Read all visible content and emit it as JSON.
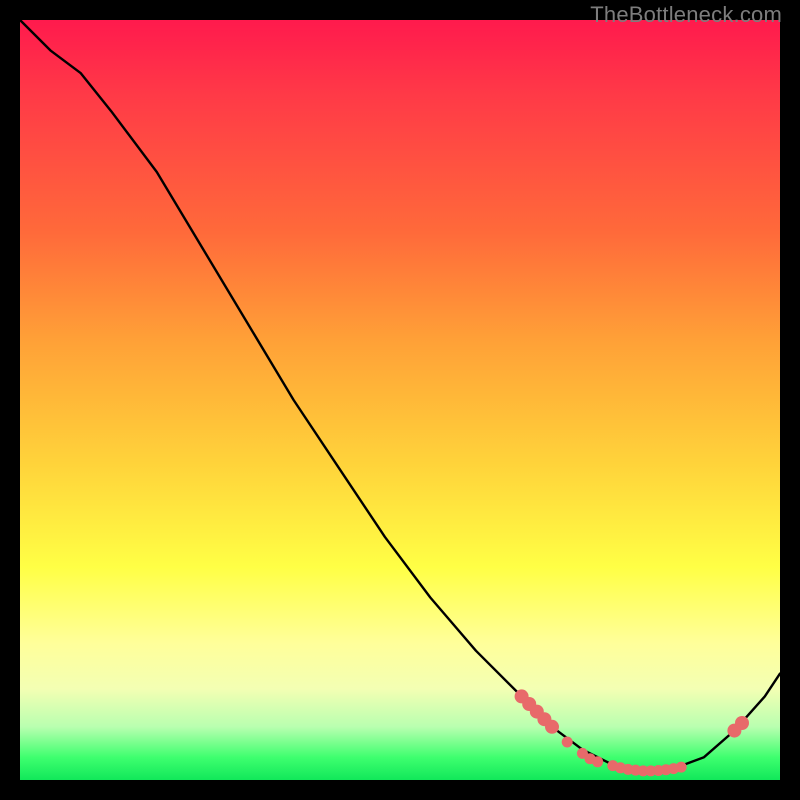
{
  "watermark": "TheBottleneck.com",
  "colors": {
    "background": "#000000",
    "gradient_stops": [
      "#ff1a4d",
      "#ff3a47",
      "#ff6a3a",
      "#ffa037",
      "#ffd23a",
      "#ffff45",
      "#ffff9a",
      "#f3ffb3",
      "#b9ffb0",
      "#3fff6f",
      "#11e85a"
    ],
    "curve": "#000000",
    "marker": "#e86a6a"
  },
  "chart_data": {
    "type": "line",
    "title": "",
    "xlabel": "",
    "ylabel": "",
    "xlim": [
      0,
      100
    ],
    "ylim": [
      0,
      100
    ],
    "grid": false,
    "legend": "none",
    "curve_xy": [
      [
        0,
        100
      ],
      [
        4,
        96
      ],
      [
        8,
        93
      ],
      [
        12,
        88
      ],
      [
        18,
        80
      ],
      [
        24,
        70
      ],
      [
        30,
        60
      ],
      [
        36,
        50
      ],
      [
        42,
        41
      ],
      [
        48,
        32
      ],
      [
        54,
        24
      ],
      [
        60,
        17
      ],
      [
        66,
        11
      ],
      [
        70,
        7
      ],
      [
        74,
        4
      ],
      [
        78,
        2
      ],
      [
        82,
        1
      ],
      [
        86,
        1.5
      ],
      [
        90,
        3
      ],
      [
        94,
        6.5
      ],
      [
        98,
        11
      ],
      [
        100,
        14
      ]
    ],
    "markers_xy": [
      [
        66,
        11
      ],
      [
        67,
        10
      ],
      [
        68,
        9
      ],
      [
        69,
        8
      ],
      [
        70,
        7
      ],
      [
        72,
        5
      ],
      [
        74,
        3.5
      ],
      [
        75,
        2.8
      ],
      [
        76,
        2.4
      ],
      [
        78,
        1.9
      ],
      [
        79,
        1.6
      ],
      [
        80,
        1.4
      ],
      [
        81,
        1.3
      ],
      [
        82,
        1.2
      ],
      [
        83,
        1.2
      ],
      [
        84,
        1.25
      ],
      [
        85,
        1.35
      ],
      [
        86,
        1.5
      ],
      [
        87,
        1.7
      ],
      [
        94,
        6.5
      ],
      [
        95,
        7.5
      ]
    ],
    "annotations": []
  }
}
